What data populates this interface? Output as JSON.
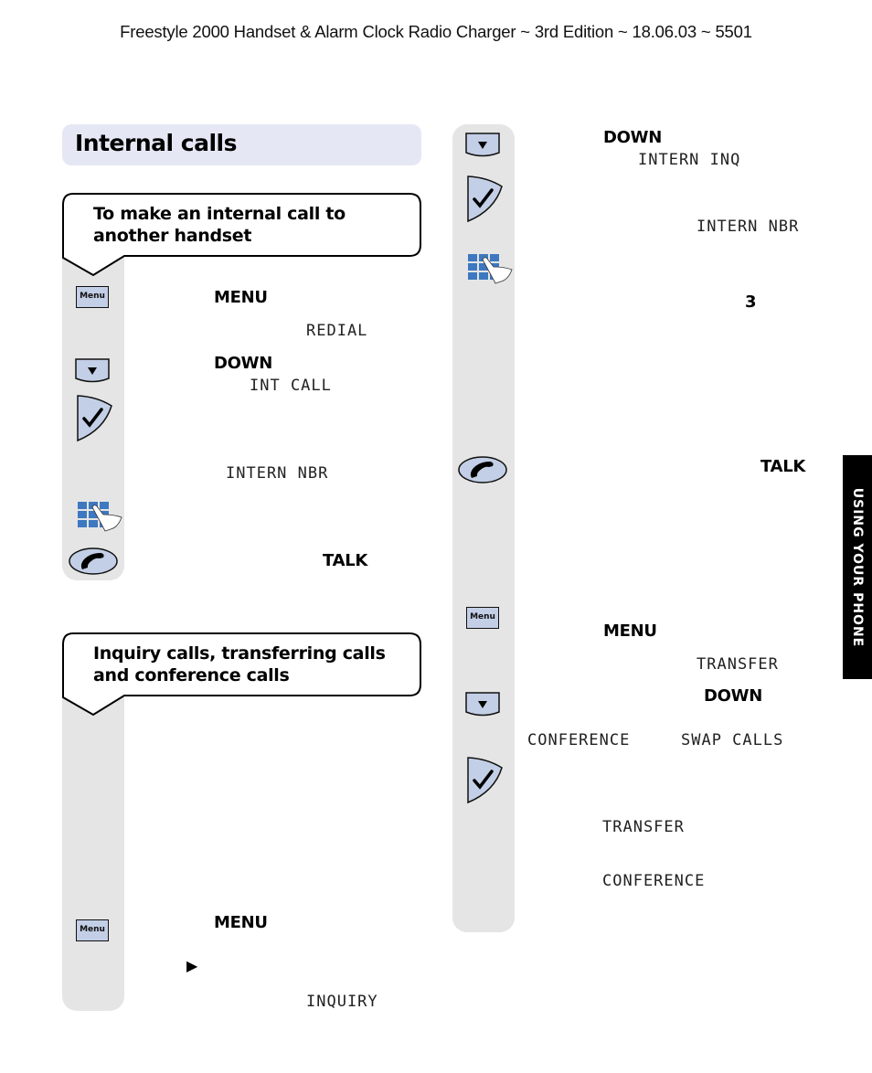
{
  "header": {
    "running_title": "Freestyle 2000 Handset & Alarm Clock Radio Charger  ~ 3rd Edition ~ 18.06.03 ~ 5501"
  },
  "section": {
    "title": "Internal calls"
  },
  "side_tab": {
    "label": "USING YOUR PHONE"
  },
  "colors": {
    "title_band": "#e5e8f4",
    "rail": "#e5e5e5",
    "key_fill": "#c3cfe6",
    "keypad_blue": "#3d78c0",
    "side_tab": "#000000"
  },
  "left_column": {
    "callout_1": "To make an internal call to another handset",
    "steps_1": [
      {
        "icon": "menu-key",
        "key_label": "MENU",
        "lcd": "REDIAL"
      },
      {
        "icon": "down-key",
        "key_label": "DOWN",
        "lcd": "INT CALL"
      },
      {
        "icon": "ok-check-key",
        "lcd": "INTERN NBR"
      },
      {
        "icon": "keypad"
      },
      {
        "icon": "talk-key",
        "key_label": "TALK"
      }
    ],
    "menu_key_text": "Menu",
    "callout_2": "Inquiry calls, transferring calls and conference calls",
    "steps_2": [
      {
        "icon": "menu-key",
        "key_label": "MENU",
        "arrow": "▶",
        "lcd": "INQUIRY"
      }
    ]
  },
  "right_column": {
    "steps": [
      {
        "icon": "down-key",
        "key_label": "DOWN",
        "lcd": "INTERN INQ"
      },
      {
        "icon": "ok-check-key",
        "lcd": "INTERN NBR"
      },
      {
        "icon": "keypad",
        "value": "3"
      },
      {
        "icon": "talk-key",
        "key_label": "TALK"
      },
      {
        "icon": "menu-key",
        "key_label": "MENU",
        "lcd": "TRANSFER"
      },
      {
        "icon": "down-key",
        "key_label": "DOWN",
        "lcd_options": [
          "CONFERENCE",
          "SWAP CALLS"
        ]
      },
      {
        "icon": "ok-check-key",
        "lcd_results": [
          "TRANSFER",
          "CONFERENCE"
        ]
      }
    ]
  }
}
